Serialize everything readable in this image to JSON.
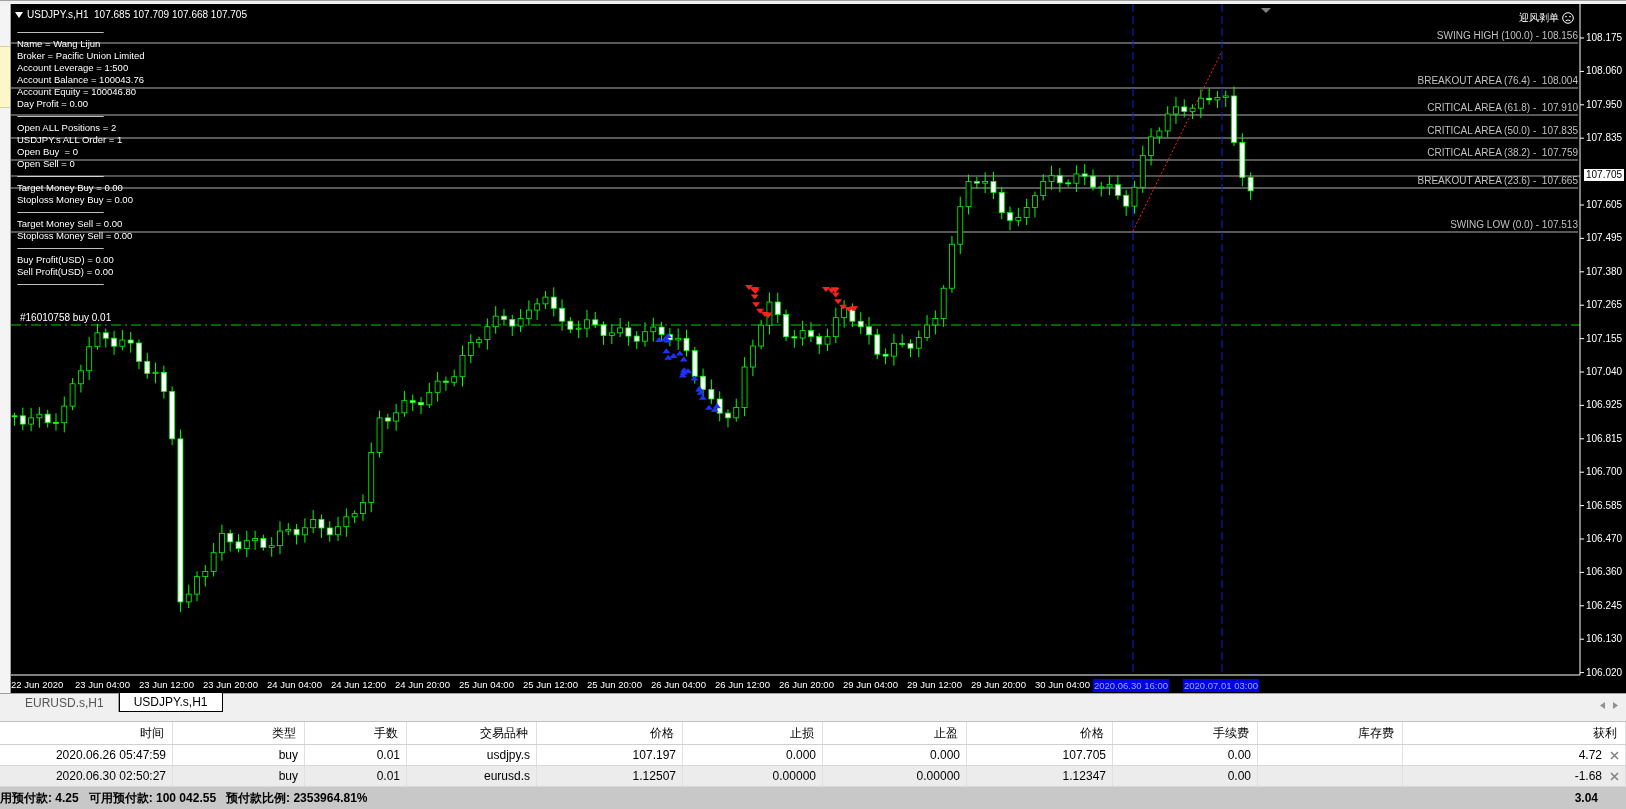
{
  "chart": {
    "header": "USDJPY.s,H1  107.685 107.709 107.668 107.705",
    "info_lines": [
      {
        "kind": "rule",
        "text": "-------------------------------------------"
      },
      {
        "kind": "text",
        "text": "Name = Wang Lijun"
      },
      {
        "kind": "text",
        "text": "Broker = Pacific Union Limited"
      },
      {
        "kind": "text",
        "text": "Account Leverage = 1:500"
      },
      {
        "kind": "text",
        "text": "Account Balance = 100043.76"
      },
      {
        "kind": "text",
        "text": "Account Equity = 100046.80"
      },
      {
        "kind": "text",
        "text": "Day Profit = 0.00"
      },
      {
        "kind": "rule",
        "text": "-------------------------------------------"
      },
      {
        "kind": "text",
        "text": "Open ALL Positions = 2"
      },
      {
        "kind": "text",
        "text": "USDJPY.s ALL Order = 1"
      },
      {
        "kind": "text",
        "text": "Open Buy  = 0"
      },
      {
        "kind": "text",
        "text": "Open Sell = 0"
      },
      {
        "kind": "rule",
        "text": "-------------------------------------------"
      },
      {
        "kind": "text",
        "text": "Target Money Buy = 0.00"
      },
      {
        "kind": "text",
        "text": "Stoploss Money Buy = 0.00"
      },
      {
        "kind": "rule",
        "text": "-------------------------------------------"
      },
      {
        "kind": "text",
        "text": "Target Money Sell = 0.00"
      },
      {
        "kind": "text",
        "text": "Stoploss Money Sell = 0.00"
      },
      {
        "kind": "rule",
        "text": "-------------------------------------------"
      },
      {
        "kind": "text",
        "text": "Buy Profit(USD) = 0.00"
      },
      {
        "kind": "text",
        "text": "Sell Profit(USD) = 0.00"
      },
      {
        "kind": "rule",
        "text": "-------------------------------------------"
      }
    ],
    "indicator_name": "迎风剥单",
    "order_label": "#16010758 buy 0.01",
    "fib_levels": [
      "SWING HIGH (100.0) - 108.156",
      "BREAKOUT AREA (76.4) -  108.004",
      "CRITICAL AREA (61.8) -  107.910",
      "CRITICAL AREA (50.0) -  107.835",
      "CRITICAL AREA (38.2) -  107.759",
      "BREAKOUT AREA (23.6) -  107.665",
      "SWING LOW (0.0) - 107.513"
    ],
    "current_price": "107.705",
    "price_axis": [
      "108.175",
      "108.060",
      "107.950",
      "107.835",
      "107.605",
      "107.495",
      "107.380",
      "107.265",
      "107.155",
      "107.040",
      "106.925",
      "106.815",
      "106.700",
      "106.585",
      "106.470",
      "106.360",
      "106.245",
      "106.130",
      "106.020"
    ],
    "time_axis": [
      "22 Jun 2020",
      "23 Jun 04:00",
      "23 Jun 12:00",
      "23 Jun 20:00",
      "24 Jun 04:00",
      "24 Jun 12:00",
      "24 Jun 20:00",
      "25 Jun 04:00",
      "25 Jun 12:00",
      "25 Jun 20:00",
      "26 Jun 04:00",
      "26 Jun 12:00",
      "26 Jun 20:00",
      "29 Jun 04:00",
      "29 Jun 12:00",
      "29 Jun 20:00",
      "30 Jun 04:00"
    ],
    "time_highlights": [
      "2020.06.30 16:00",
      "2020.07.01 03:00"
    ]
  },
  "tabs": [
    {
      "label": "EURUSD.s,H1",
      "selected": false
    },
    {
      "label": "USDJPY.s,H1",
      "selected": true
    }
  ],
  "table": {
    "columns": [
      "时间",
      "类型",
      "手数",
      "交易品种",
      "价格",
      "止损",
      "止盈",
      "价格",
      "手续费",
      "库存费",
      "获利"
    ],
    "rows": [
      {
        "cells": [
          "2020.06.26 05:47:59",
          "buy",
          "0.01",
          "usdjpy.s",
          "107.197",
          "0.000",
          "0.000",
          "107.705",
          "0.00",
          null,
          "4.72"
        ]
      },
      {
        "cells": [
          "2020.06.30 02:50:27",
          "buy",
          "0.01",
          "eurusd.s",
          "1.12507",
          "0.00000",
          "0.00000",
          "1.12347",
          "0.00",
          null,
          "-1.68"
        ]
      }
    ]
  },
  "status_bar": {
    "items": [
      "用预付款: 4.25",
      "可用预付款: 100 042.55",
      "预付款比例: 2353964.81%"
    ],
    "total": "3.04"
  }
}
